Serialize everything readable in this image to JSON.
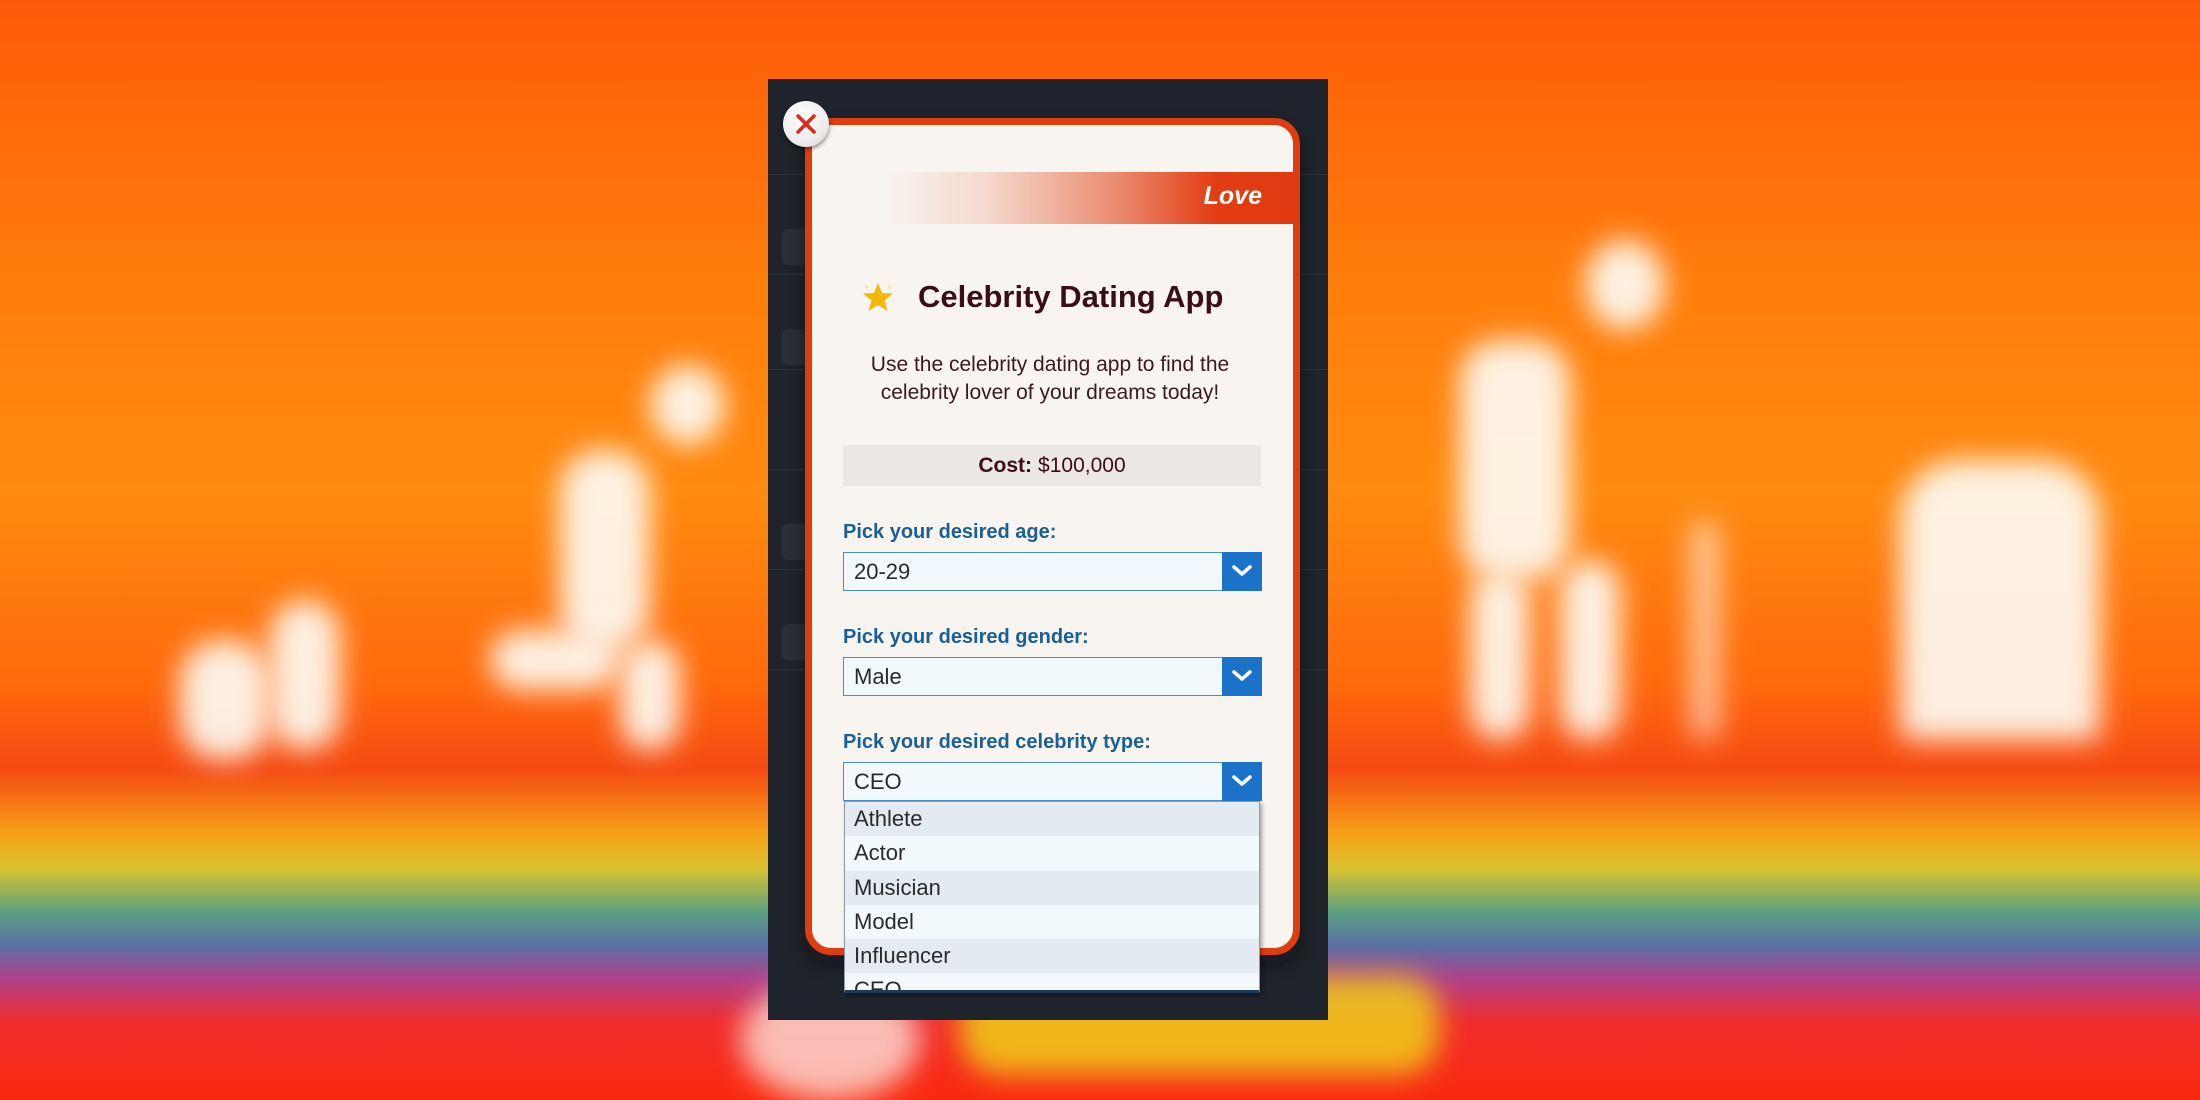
{
  "modal": {
    "category": "Love",
    "title": "Celebrity Dating App",
    "title_icon": "star-icon",
    "description": "Use the celebrity dating app to find the celebrity lover of your dreams today!",
    "cost_label": "Cost:",
    "cost_value": "$100,000",
    "close_icon": "close-icon"
  },
  "fields": {
    "age": {
      "label": "Pick your desired age:",
      "value": "20-29"
    },
    "gender": {
      "label": "Pick your desired gender:",
      "value": "Male"
    },
    "celebrity_type": {
      "label": "Pick your desired celebrity type:",
      "value": "CEO",
      "options": [
        "Athlete",
        "Actor",
        "Musician",
        "Model",
        "Influencer",
        "CEO"
      ]
    }
  },
  "colors": {
    "accent_red": "#df3c10",
    "label_blue": "#1a5f96",
    "select_button_blue": "#1a73c8",
    "title_maroon": "#3b0d14",
    "star_yellow": "#f5b800"
  }
}
